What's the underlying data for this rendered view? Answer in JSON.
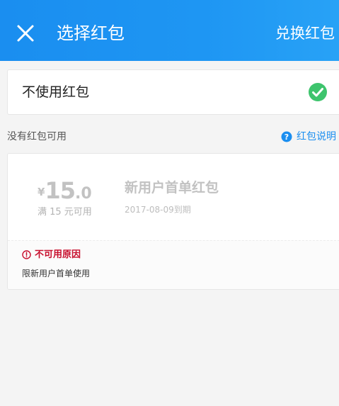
{
  "header": {
    "title": "选择红包",
    "exchange_label": "兑换红包",
    "color": "#1a8ef0"
  },
  "no_use": {
    "label": "不使用红包",
    "selected": true,
    "check_color": "#3ec46d"
  },
  "section": {
    "title": "没有红包可用",
    "help_label": "红包说明"
  },
  "coupon": {
    "currency": "¥",
    "amount_int": "15",
    "amount_dec": ".0",
    "threshold": "满 15 元可用",
    "name": "新用户首单红包",
    "expiry": "2017-08-09到期",
    "reason_title": "不可用原因",
    "reason_text": "限新用户首单使用",
    "reason_color": "#c8102e"
  },
  "icons": {
    "close": "close-icon",
    "check": "check-circle-icon",
    "help": "question-circle-icon",
    "alert": "alert-circle-icon"
  }
}
